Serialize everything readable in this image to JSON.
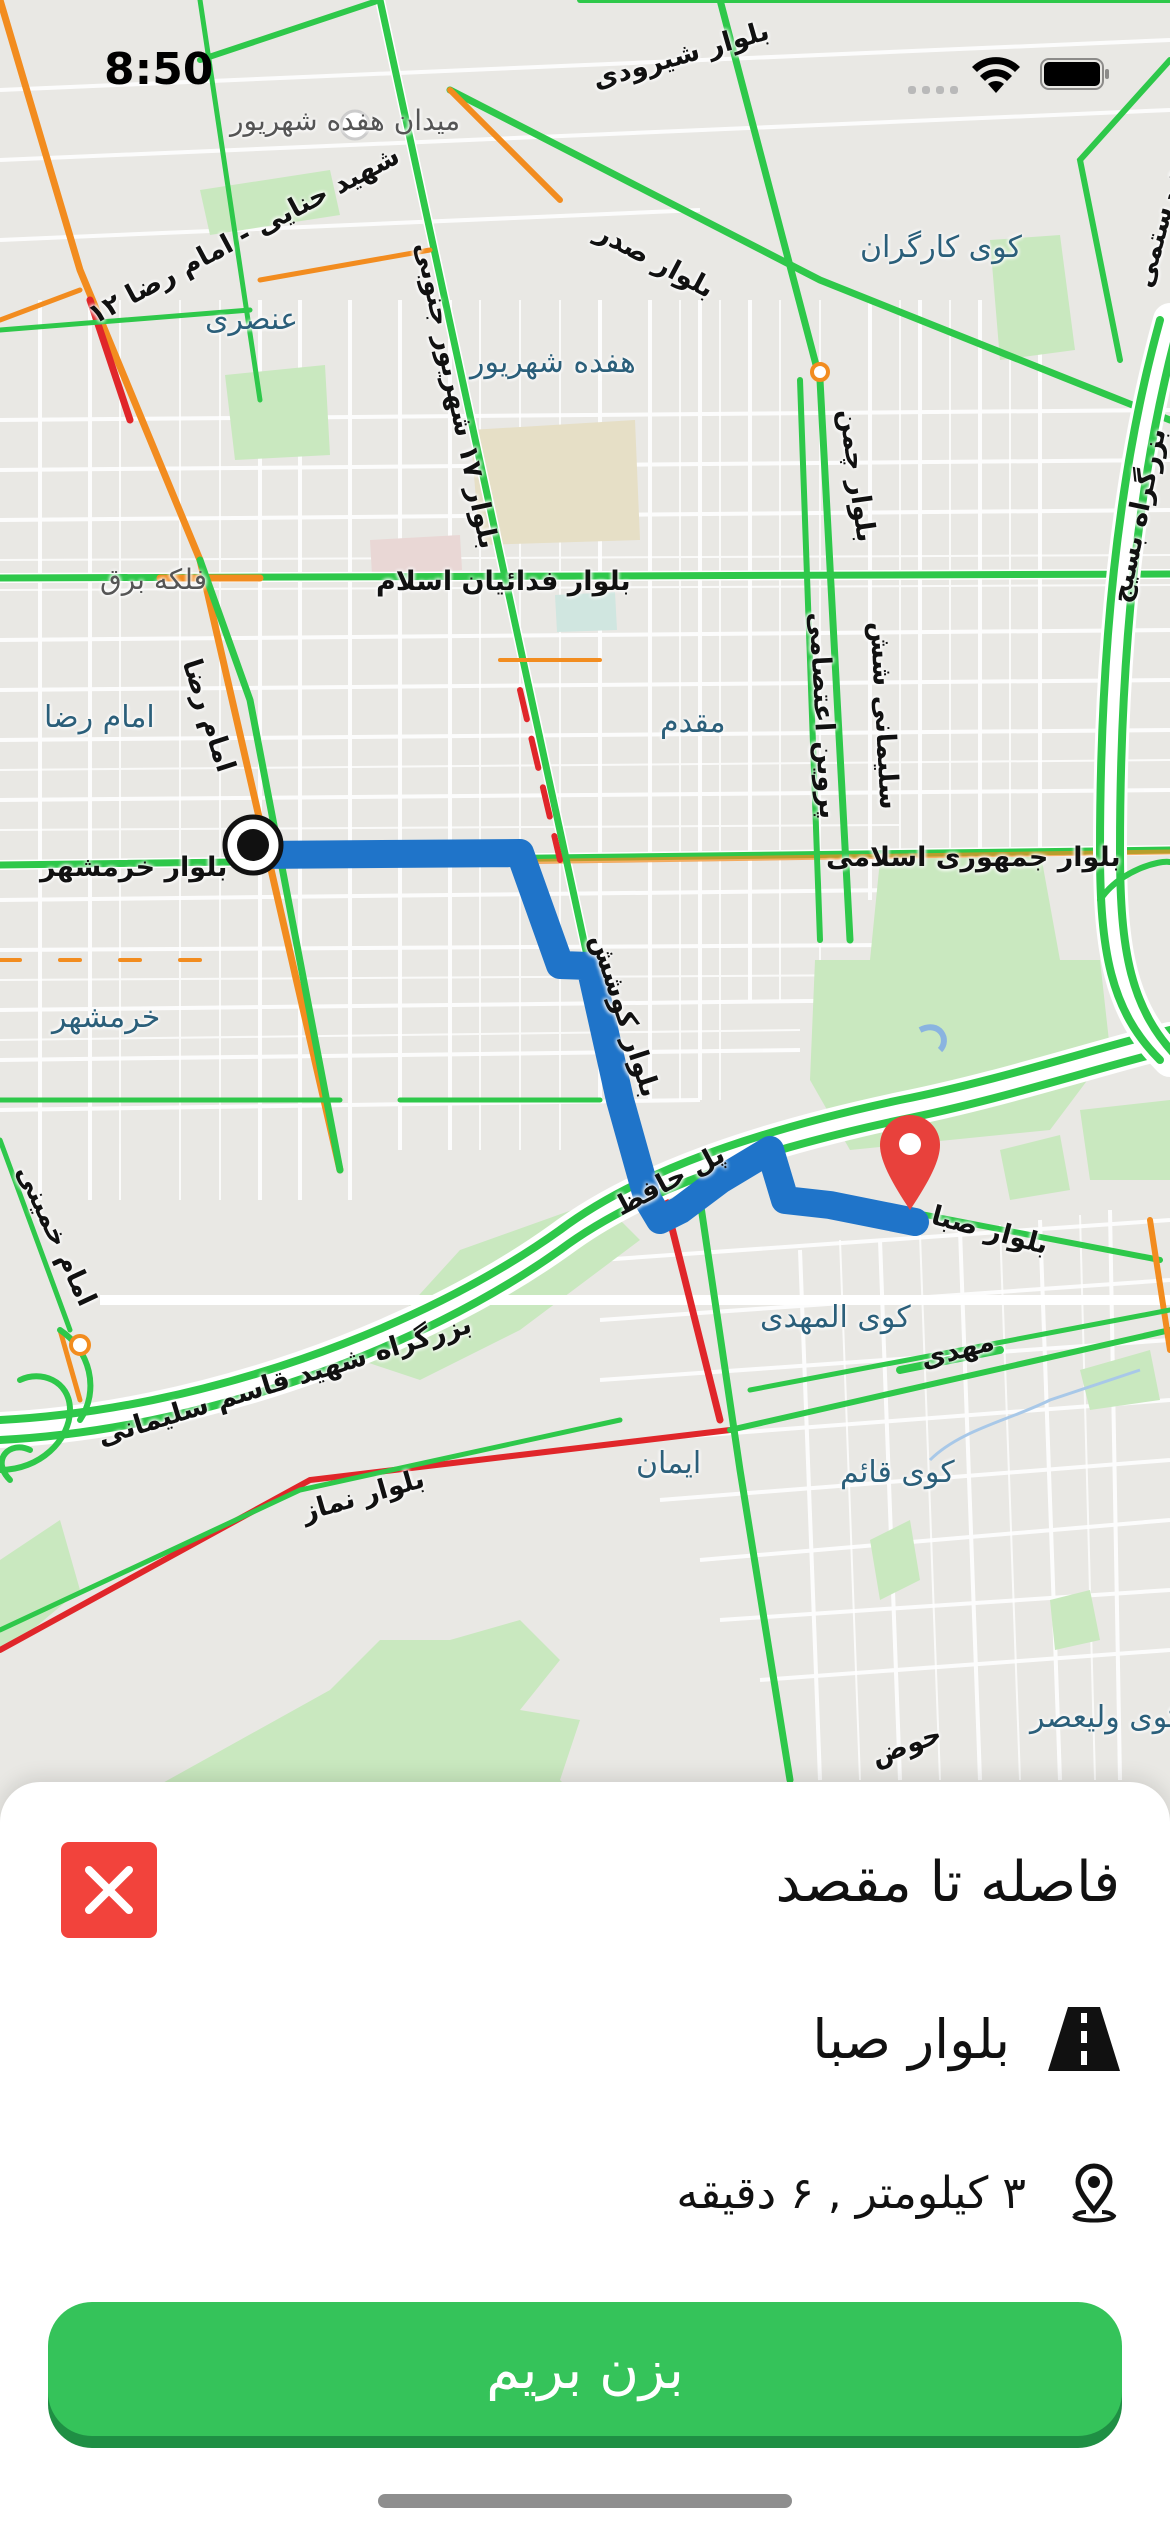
{
  "status_bar": {
    "time": "8:50"
  },
  "map": {
    "streets": [
      {
        "id": "shirudi",
        "label": "بلوار شیرودی"
      },
      {
        "id": "shahid_rostami",
        "label": "بلوار شهید رستمی"
      },
      {
        "id": "sadr",
        "label": "بلوار صدر"
      },
      {
        "id": "shahid_hanai",
        "label": "شهید حنایی - امام رضا ۱۲"
      },
      {
        "id": "shahrivar_17",
        "label": "بلوار ۱۷ شهریور جنوبی"
      },
      {
        "id": "chamran",
        "label": "بلوار چمن"
      },
      {
        "id": "basij",
        "label": "بزرگراه بسیج"
      },
      {
        "id": "fadaeian",
        "label": "بلوار فدائیان اسلام"
      },
      {
        "id": "parvin",
        "label": "پروین اعتصامی"
      },
      {
        "id": "soleimani_shesh",
        "label": "سلیمانی شش"
      },
      {
        "id": "imam_reza",
        "label": "امام رضا"
      },
      {
        "id": "khorramshahr_blvd",
        "label": "بلوار خرمشهر"
      },
      {
        "id": "jomhouri",
        "label": "بلوار جمهوری اسلامی"
      },
      {
        "id": "kushesh",
        "label": "بلوار کوشش"
      },
      {
        "id": "hafez_bridge",
        "label": "پل حافظ"
      },
      {
        "id": "saba",
        "label": "بلوار صبا"
      },
      {
        "id": "mahdi",
        "label": "مهدی"
      },
      {
        "id": "soleimani_hwy",
        "label": "بزرگراه شهید قاسم سلیمانی"
      },
      {
        "id": "namaz",
        "label": "بلوار نماز"
      },
      {
        "id": "imam_khomeini",
        "label": "امام خمینی"
      },
      {
        "id": "hoz",
        "label": "حوض"
      }
    ],
    "areas": [
      {
        "id": "meydan",
        "label": "میدان هفده شهریور"
      },
      {
        "id": "kargaran",
        "label": "کوی کارگران"
      },
      {
        "id": "onsori",
        "label": "عنصری"
      },
      {
        "id": "hefdah_shahrivar",
        "label": "هفده شهریور"
      },
      {
        "id": "falake_bargh",
        "label": "فلکه برق"
      },
      {
        "id": "imam_reza_area",
        "label": "امام رضا"
      },
      {
        "id": "moghaddam",
        "label": "مقدم"
      },
      {
        "id": "khorramshahr",
        "label": "خرمشهر"
      },
      {
        "id": "kuye_almahdi",
        "label": "کوی المهدی"
      },
      {
        "id": "iman",
        "label": "ایمان"
      },
      {
        "id": "kuye_ghaem",
        "label": "کوی قائم"
      },
      {
        "id": "kuye_valiasr",
        "label": "کوی ولیعصر"
      }
    ],
    "colors": {
      "route": "#1f74c9",
      "traffic_green": "#2ec84a",
      "traffic_orange": "#f28c1f",
      "traffic_red": "#e0262a",
      "park": "#c9e8bf",
      "destination_pin": "#e8413c"
    }
  },
  "sheet": {
    "title": "فاصله تا مقصد",
    "street_name": "بلوار صبا",
    "distance_time": "۳ کیلومتر , ۶ دقیقه",
    "go_label": "بزن بریم",
    "icons": {
      "close": "close-icon",
      "road": "road-icon",
      "location": "location-pin-icon"
    },
    "colors": {
      "close_bg": "#f2433c",
      "go_bg": "#35c35a"
    }
  }
}
